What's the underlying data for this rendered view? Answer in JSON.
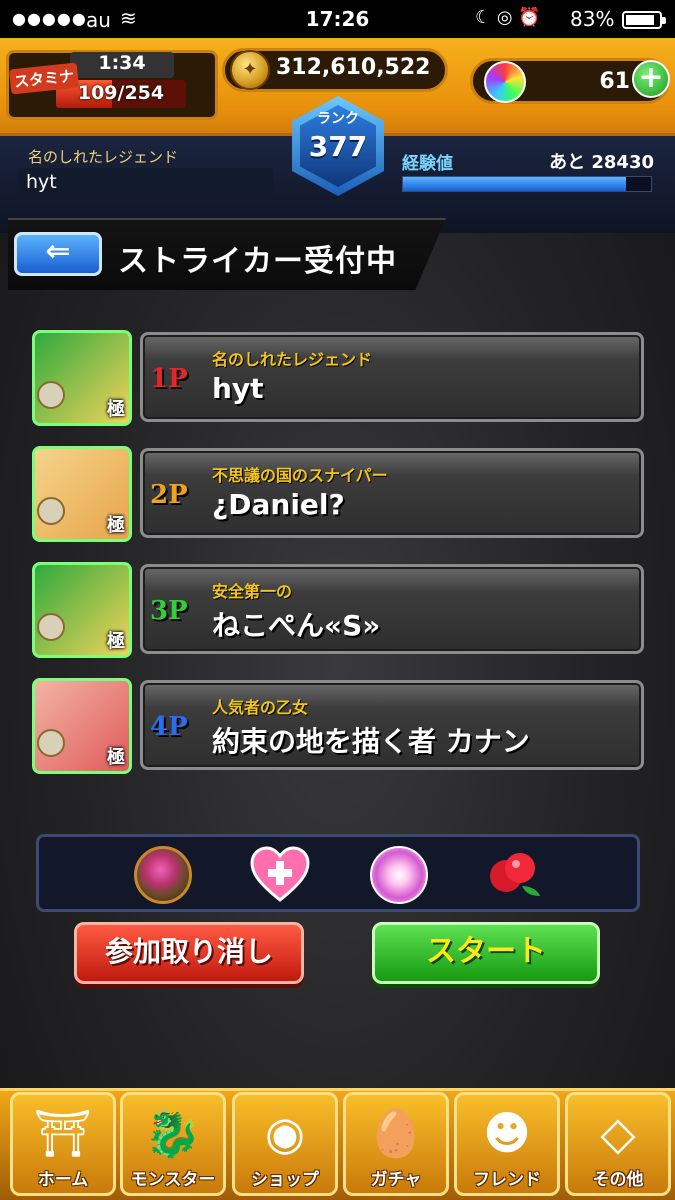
{
  "status_bar": {
    "signal": "●●●●●",
    "carrier": "au",
    "time": "17:26",
    "battery": "83%",
    "battery_level": 0.83
  },
  "hud": {
    "stamina_label": "スタミナ",
    "stamina_timer": "1:34",
    "stamina_value": "109/254",
    "stamina_ratio": 0.43,
    "coins": "312,610,522",
    "orbs": "61",
    "rank_label": "ランク",
    "rank_value": "377",
    "player_title": "名のしれたレジェンド",
    "player_name": "hyt",
    "exp_label": "経験値",
    "exp_remaining": "あと 28430",
    "exp_ratio": 0.9
  },
  "section": {
    "back_glyph": "⇐",
    "title": "ストライカー受付中"
  },
  "players": [
    {
      "slot": "1P",
      "color": "#e8262a",
      "title": "名のしれたレジェンド",
      "name": "hyt",
      "grade": "極",
      "avatar_colors": [
        "#2faa3e",
        "#f2d35a"
      ]
    },
    {
      "slot": "2P",
      "color": "#f0a21c",
      "title": "不思議の国のスナイパー",
      "name": "¿Daniel?",
      "grade": "極",
      "avatar_colors": [
        "#f4d48a",
        "#e8a44a"
      ]
    },
    {
      "slot": "3P",
      "color": "#2fd03a",
      "title": "安全第一の",
      "name": "ねこぺん«S»",
      "grade": "極",
      "avatar_colors": [
        "#2faa3e",
        "#f2d35a"
      ]
    },
    {
      "slot": "4P",
      "color": "#2a6ef0",
      "title": "人気者の乙女",
      "name": "約束の地を描く者 カナン",
      "grade": "極",
      "avatar_colors": [
        "#f2b4a4",
        "#e05a5a"
      ]
    }
  ],
  "items": [
    {
      "icon": "boost-orb-icon"
    },
    {
      "icon": "heart-plus-icon"
    },
    {
      "icon": "spark-orb-icon"
    },
    {
      "icon": "red-fruit-icon"
    }
  ],
  "buttons": {
    "cancel": "参加取り消し",
    "start": "スタート"
  },
  "nav": [
    {
      "label": "ホーム",
      "icon": "home-icon",
      "glyph": "⛩"
    },
    {
      "label": "モンスター",
      "icon": "monster-icon",
      "glyph": "🐉"
    },
    {
      "label": "ショップ",
      "icon": "shop-orb-icon",
      "glyph": "◉"
    },
    {
      "label": "ガチャ",
      "icon": "gacha-egg-icon",
      "glyph": "🥚"
    },
    {
      "label": "フレンド",
      "icon": "friend-icon",
      "glyph": "☻"
    },
    {
      "label": "その他",
      "icon": "other-icon",
      "glyph": "◇"
    }
  ]
}
